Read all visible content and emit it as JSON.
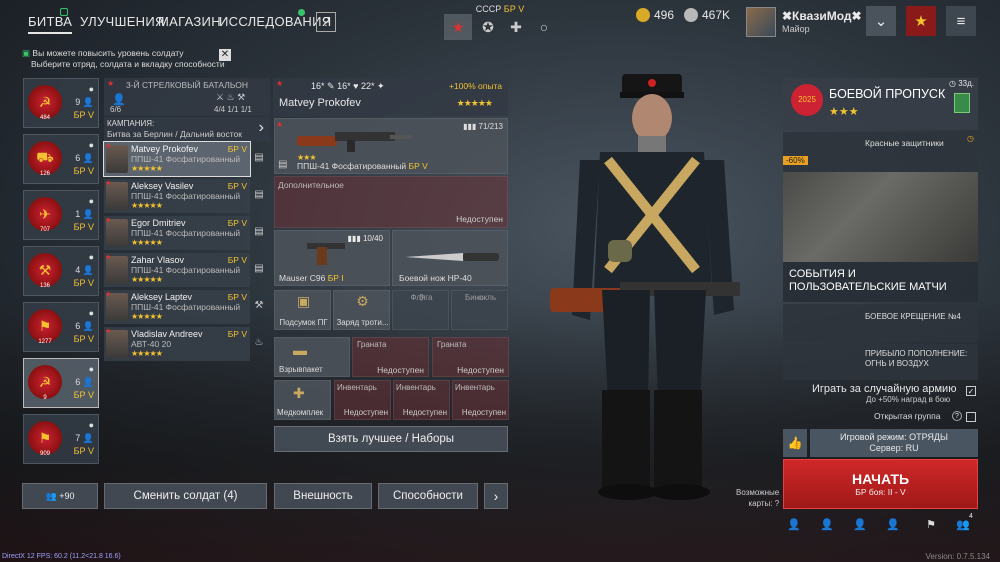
{
  "nav": {
    "tabs": [
      "БИТВА",
      "УЛУЧШЕНИЯ",
      "МАГАЗИН",
      "ИССЛЕДОВАНИЯ"
    ],
    "help": "?",
    "nation_label": "СССР",
    "nation_br": "БР V",
    "gold": "496",
    "silver": "467K",
    "username": "✖КвазиМод✖",
    "rank": "Майор"
  },
  "notice": {
    "line1": "Вы можете повысить уровень солдату",
    "line2": "Выберите отряд, солдата и вкладку способности"
  },
  "squads": [
    {
      "num": "484",
      "count": "9",
      "br": "БР V"
    },
    {
      "num": "126",
      "count": "6",
      "br": "БР V"
    },
    {
      "num": "707",
      "count": "1",
      "br": "БР V"
    },
    {
      "num": "136",
      "count": "4",
      "br": "БР V"
    },
    {
      "num": "1277",
      "count": "6",
      "br": "БР V"
    },
    {
      "num": "9",
      "count": "6",
      "br": "БР V"
    },
    {
      "num": "909",
      "count": "7",
      "br": "БР V"
    }
  ],
  "battalion": {
    "title": "3-Й СТРЕЛКОВЫЙ БАТАЛЬОН",
    "soldiers": "6/6",
    "s1": "4/4",
    "s2": "1/1",
    "s3": "1/1",
    "campaign_label": "КАМПАНИЯ:",
    "campaign_value": "Битва за Берлин / Дальний восток"
  },
  "soldiers": [
    {
      "name": "Matvey Prokofev",
      "weapon": "ППШ-41 Фосфатированный",
      "br": "БР V",
      "stars": "★★★★★"
    },
    {
      "name": "Aleksey Vasilev",
      "weapon": "ППШ-41 Фосфатированный",
      "br": "БР V",
      "stars": "★★★★★"
    },
    {
      "name": "Egor Dmitriev",
      "weapon": "ППШ-41 Фосфатированный",
      "br": "БР V",
      "stars": "★★★★★"
    },
    {
      "name": "Zahar Vlasov",
      "weapon": "ППШ-41 Фосфатированный",
      "br": "БР V",
      "stars": "★★★★★"
    },
    {
      "name": "Aleksey Laptev",
      "weapon": "ППШ-41 Фосфатированный",
      "br": "БР V",
      "stars": "★★★★★"
    },
    {
      "name": "Vladislav Andreev",
      "weapon": "АВТ-40 20",
      "br": "БР V",
      "stars": "★★★★★"
    }
  ],
  "loadout": {
    "stat1": "16*",
    "stat2": "16*",
    "stat3": "22*",
    "exp": "+100% опыта",
    "name": "Matvey Prokofev",
    "stars": "★★★★★",
    "primary": {
      "name": "ППШ-41 Фосфатированный",
      "br": "БР V",
      "ammo": "71/213",
      "stars": "★★★"
    },
    "extra": {
      "label": "Дополнительное",
      "status": "Недоступен"
    },
    "pistol": {
      "name": "Mauser C96",
      "br": "БР I",
      "ammo": "10/40"
    },
    "knife": {
      "name": "Боевой нож НР-40"
    },
    "items": [
      "Подсумок ПГ",
      "Заряд троти...",
      "Фляга",
      "Бинокль"
    ],
    "row3": [
      {
        "label": "Взрывпакет",
        "status": ""
      },
      {
        "label": "Граната",
        "status": "Недоступен"
      },
      {
        "label": "Граната",
        "status": "Недоступен"
      }
    ],
    "row4": [
      {
        "label": "Медкомплек",
        "status": ""
      },
      {
        "label": "Инвентарь",
        "status": "Недоступен"
      },
      {
        "label": "Инвентарь",
        "status": "Недоступен"
      },
      {
        "label": "Инвентарь",
        "status": "Недоступен"
      }
    ],
    "best_button": "Взять лучшее / Наборы"
  },
  "bottom": {
    "reserve": "+90",
    "change": "Сменить солдат (4)",
    "appearance": "Внешность",
    "abilities": "Способности",
    "arrow": "›"
  },
  "right": {
    "pass_title": "БОЕВОЙ ПРОПУСК",
    "pass_stars": "★★★",
    "pass_days": "33д.",
    "pass_year": "2025",
    "red_def": "Красные защитники",
    "discount": "-60%",
    "events_title": "СОБЫТИЯ И ПОЛЬЗОВАТЕЛЬСКИЕ МАТЧИ",
    "ev1": "БОЕВОЕ КРЕЩЕНИЕ №4",
    "ev2": "ПРИБЫЛО ПОПОЛНЕНИЕ: ОГНЬ И ВОЗДУХ",
    "random_army": "Играть за случайную армию",
    "bonus": "До +50% наград в бою",
    "open_group": "Открытая группа",
    "mode": "Игровой режим: ОТРЯДЫ",
    "server": "Сервер: RU",
    "start": "НАЧАТЬ",
    "start_br": "БР боя: II - V",
    "possible": "Возможные",
    "cards": "карты:",
    "party_count": "4"
  },
  "footer": {
    "fps": "DirectX 12 FPS: 60.2 (11.2<21.8 16.6)",
    "version": "Version: 0.7.5.134"
  },
  "colors": {
    "accent": "#f2c230",
    "danger": "#c42020",
    "panel": "#323a44"
  }
}
